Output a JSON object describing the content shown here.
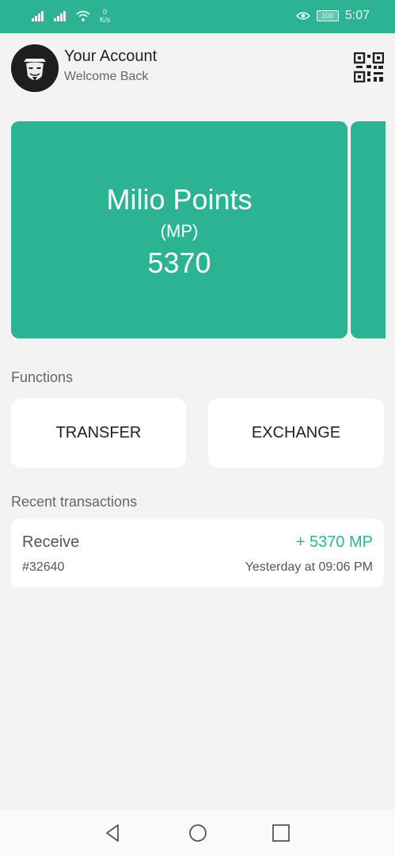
{
  "status_bar": {
    "speed_value": "0",
    "speed_unit": "K/s",
    "battery": "100",
    "time": "5:07"
  },
  "header": {
    "title": "Your Account",
    "subtitle": "Welcome Back"
  },
  "points_card": {
    "name": "Milio Points",
    "unit": "(MP)",
    "value": "5370"
  },
  "functions": {
    "label": "Functions",
    "transfer": "TRANSFER",
    "exchange": "EXCHANGE"
  },
  "transactions": {
    "label": "Recent transactions",
    "items": [
      {
        "type": "Receive",
        "amount": "+ 5370 MP",
        "id": "#32640",
        "time": "Yesterday at 09:06 PM"
      }
    ]
  },
  "colors": {
    "accent": "#2cb394",
    "background": "#f3f3f3"
  },
  "icons": [
    "signal-icon",
    "wifi-icon",
    "eye-icon",
    "battery-icon",
    "avatar-mask-icon",
    "qr-code-icon",
    "back-icon",
    "home-icon",
    "recents-icon"
  ]
}
